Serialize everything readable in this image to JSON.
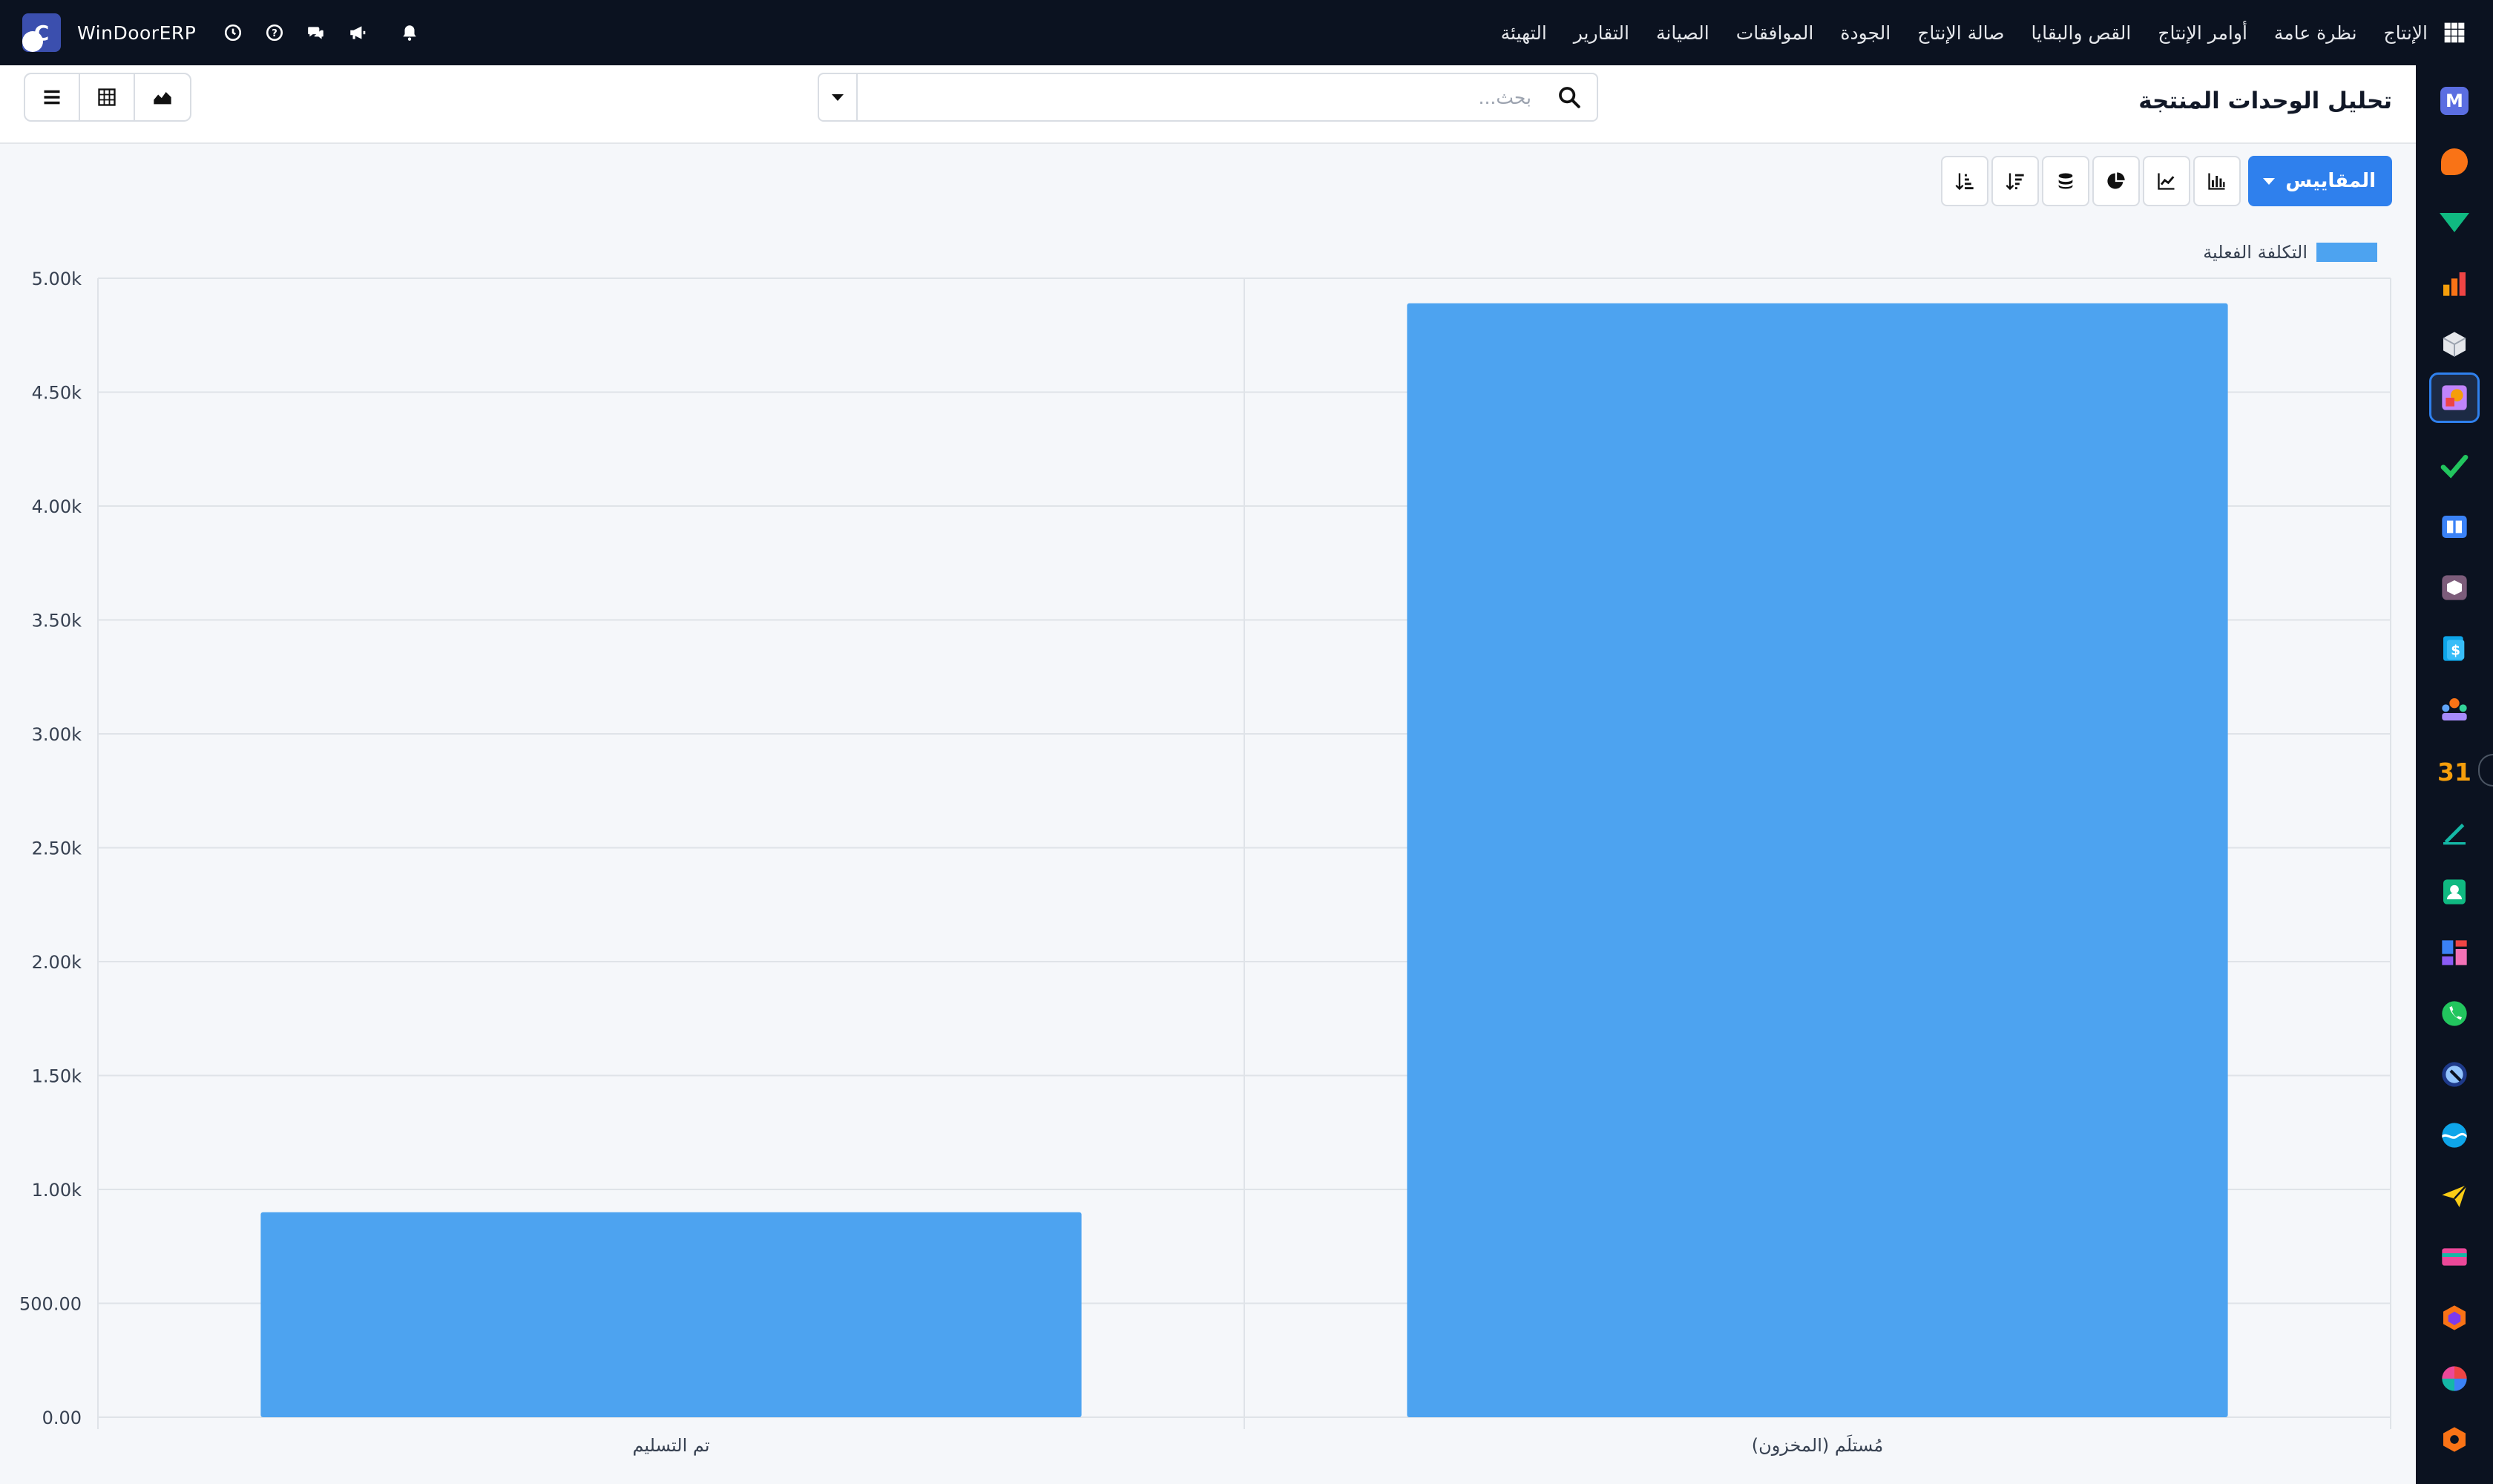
{
  "app": {
    "brand_name": "WinDoorERP",
    "brand_initial": "C"
  },
  "nav": {
    "items": [
      "الإنتاج",
      "نظرة عامة",
      "أوامر الإنتاج",
      "القص والبقايا",
      "صالة الإنتاج",
      "الجودة",
      "الموافقات",
      "الصيانة",
      "التقارير",
      "التهيئة"
    ]
  },
  "page": {
    "title": "تحليل الوحدات المنتجة"
  },
  "search": {
    "placeholder": "بحث...",
    "value": ""
  },
  "toolbar": {
    "measures_label": "المقاييس",
    "buttons": [
      "bar-chart-icon",
      "line-chart-icon",
      "pie-chart-icon",
      "stack-icon",
      "sort-descending-icon",
      "sort-ascending-icon"
    ]
  },
  "views": [
    "list-view-icon",
    "pivot-view-icon",
    "graph-view-icon"
  ],
  "colors": {
    "bar": "#4da3f0",
    "accent": "#2f80ed",
    "topbar": "#0b1220"
  },
  "chart_data": {
    "type": "bar",
    "categories": [
      "تم التسليم",
      "مُستلَم (المخزون)"
    ],
    "series": [
      {
        "name": "التكلفة الفعلية",
        "values": [
          900,
          4890
        ]
      }
    ],
    "ylim": [
      0,
      5000
    ],
    "yticks": [
      "0.00",
      "500.00",
      "1.00k",
      "1.50k",
      "2.00k",
      "2.50k",
      "3.00k",
      "3.50k",
      "4.00k",
      "4.50k",
      "5.00k"
    ],
    "grid": true,
    "legend": "top-right"
  }
}
